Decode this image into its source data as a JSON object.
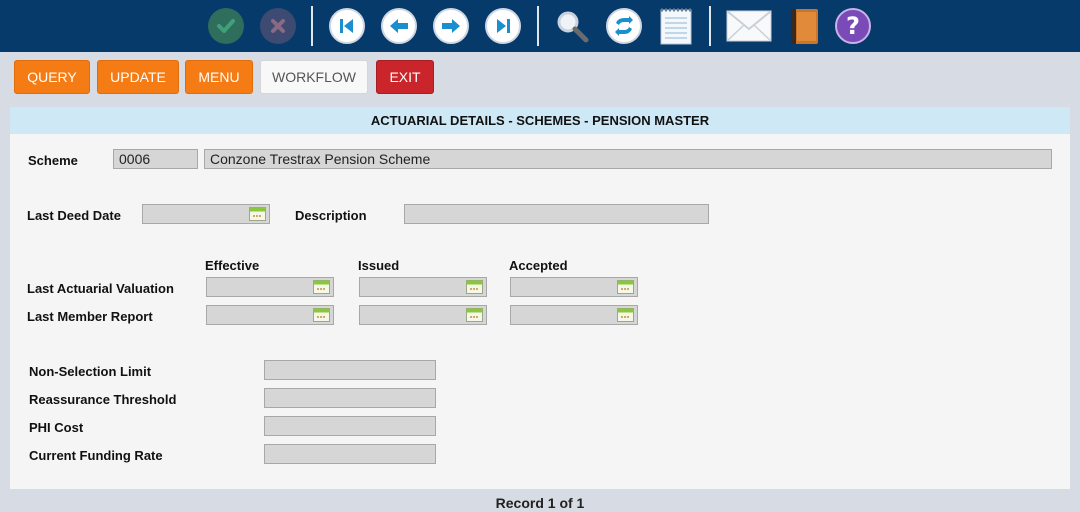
{
  "toolbar": {
    "icons": [
      "check-icon",
      "cancel-icon",
      "first-record-icon",
      "previous-record-icon",
      "next-record-icon",
      "last-record-icon",
      "search-icon",
      "refresh-icon",
      "notes-icon",
      "mail-icon",
      "book-icon",
      "help-icon"
    ],
    "colors": {
      "bar": "#053a6b",
      "nav_accent": "#1a8ecf"
    }
  },
  "actions": {
    "query": "QUERY",
    "update": "UPDATE",
    "menu": "MENU",
    "workflow": "WORKFLOW",
    "exit": "EXIT",
    "colors": {
      "orange": "#f57c14",
      "red": "#c9252a"
    }
  },
  "panel": {
    "title": "ACTUARIAL DETAILS - SCHEMES - PENSION MASTER",
    "scheme": {
      "label": "Scheme",
      "code": "0006",
      "name": "Conzone Trestrax Pension Scheme"
    },
    "last_deed_date": {
      "label": "Last Deed Date",
      "value": ""
    },
    "description": {
      "label": "Description",
      "value": ""
    },
    "columns": {
      "effective": "Effective",
      "issued": "Issued",
      "accepted": "Accepted"
    },
    "rows": {
      "actuarial_valuation": {
        "label": "Last Actuarial Valuation",
        "effective": "",
        "issued": "",
        "accepted": ""
      },
      "member_report": {
        "label": "Last Member Report",
        "effective": "",
        "issued": "",
        "accepted": ""
      }
    },
    "limits": {
      "non_selection_limit": {
        "label": "Non-Selection Limit",
        "value": ""
      },
      "reassurance_threshold": {
        "label": "Reassurance Threshold",
        "value": ""
      },
      "phi_cost": {
        "label": "PHI Cost",
        "value": ""
      },
      "current_funding_rate": {
        "label": "Current Funding Rate",
        "value": ""
      }
    }
  },
  "footer": {
    "record": "Record 1 of 1"
  }
}
